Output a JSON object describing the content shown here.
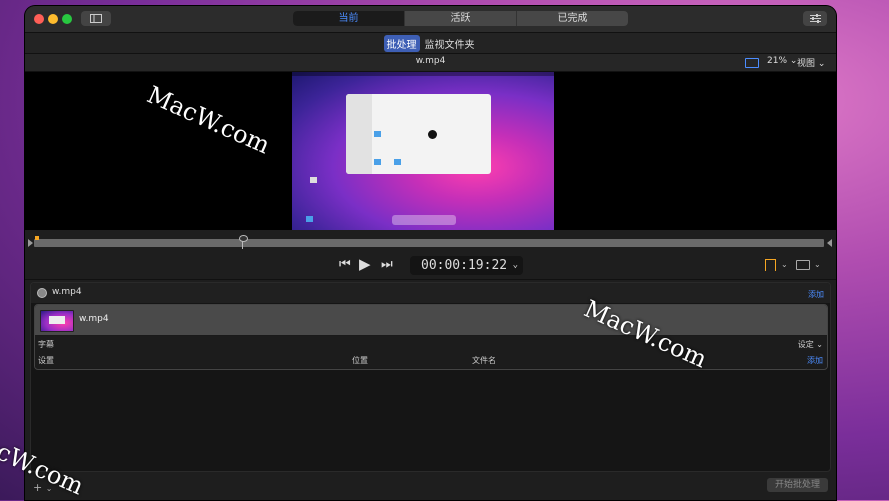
{
  "tabs": [
    "当前",
    "活跃",
    "已完成"
  ],
  "subtabs": [
    "批处理",
    "监视文件夹"
  ],
  "infobar": {
    "filename": "w.mp4",
    "zoom": "21%",
    "view": "视图"
  },
  "timecode": "00:00:19:22",
  "batch": {
    "name": "w.mp4",
    "add": "添加",
    "job": {
      "name": "w.mp4",
      "subtitle": "字幕",
      "settings_menu": "设定",
      "columns": [
        "设置",
        "位置",
        "文件名"
      ],
      "add": "添加"
    }
  },
  "footer": {
    "start": "开始批处理",
    "add": "+"
  },
  "watermarks": [
    "MacW.com",
    "MacW.com",
    "cW.com"
  ],
  "colors": {
    "accent": "#4c8dff",
    "bookmark": "#f5a623"
  }
}
